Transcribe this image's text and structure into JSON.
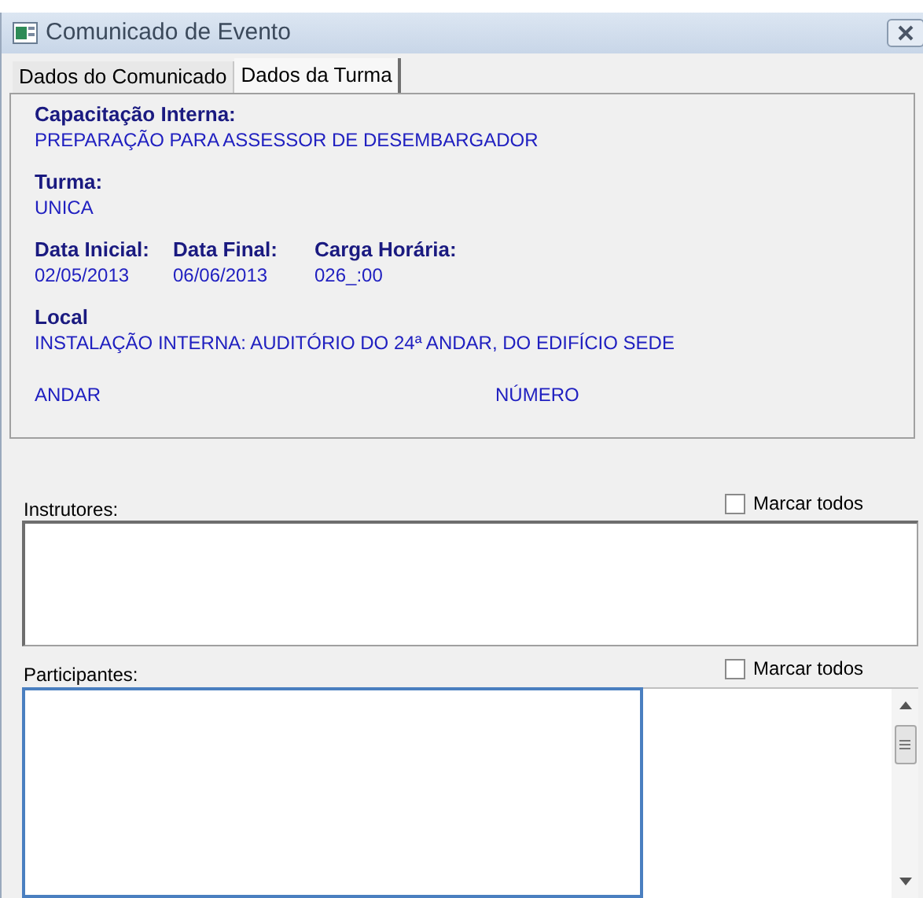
{
  "window": {
    "title": "Comunicado de Evento"
  },
  "tabs": [
    {
      "label": "Dados do Comunicado",
      "selected": false
    },
    {
      "label": "Dados da Turma",
      "selected": true
    }
  ],
  "details": [
    {
      "kind": "field",
      "label": "Capacitação Interna:",
      "value": "PREPARAÇÃO PARA ASSESSOR DE DESEMBARGADOR"
    },
    {
      "kind": "field",
      "label": "Turma:",
      "value": "UNICA"
    },
    {
      "kind": "row",
      "items": [
        {
          "label": "Data Inicial:",
          "value": "02/05/2013"
        },
        {
          "label": "Data Final:",
          "value": "06/06/2013"
        },
        {
          "label": "Carga Horária:",
          "value": "026_:00"
        }
      ]
    },
    {
      "kind": "field",
      "label": "Local",
      "value": "INSTALAÇÃO INTERNA: AUDITÓRIO DO 24ª ANDAR, DO EDIFÍCIO SEDE"
    },
    {
      "kind": "pair",
      "items": [
        "ANDAR",
        "NÚMERO"
      ]
    }
  ],
  "instrutores": {
    "label": "Instrutores:",
    "mark_all": {
      "label": "Marcar todos",
      "checked": false
    }
  },
  "participantes": {
    "label": "Participantes:",
    "mark_all": {
      "label": "Marcar todos",
      "checked": false
    }
  }
}
